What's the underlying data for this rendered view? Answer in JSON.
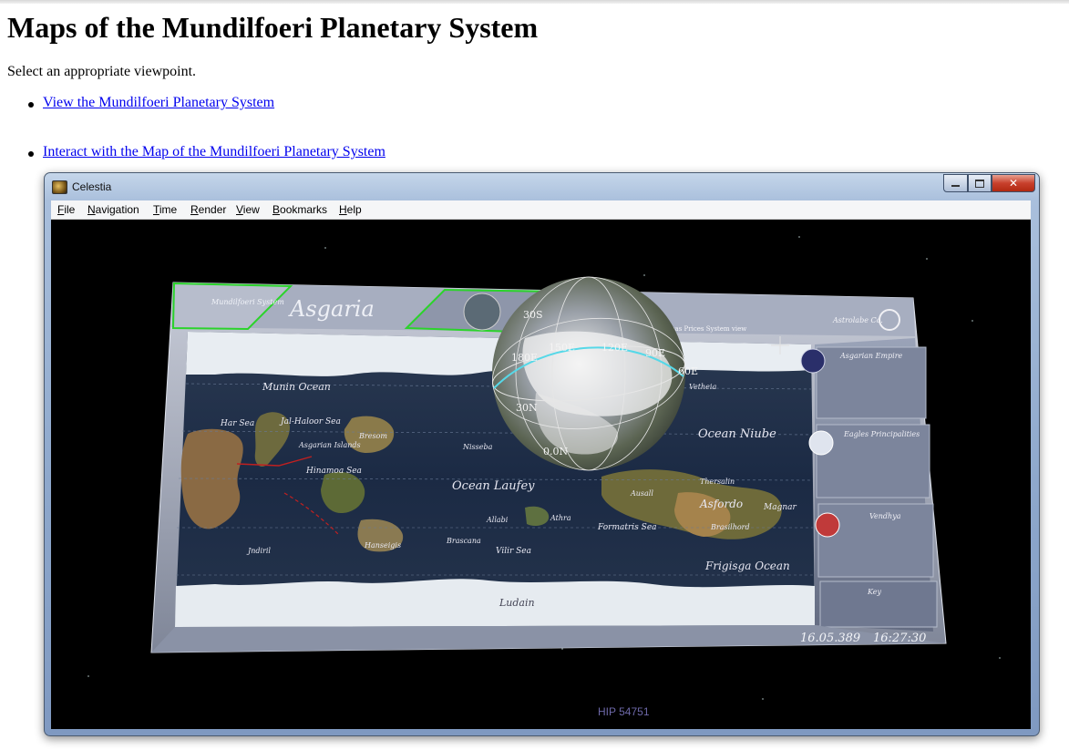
{
  "page": {
    "title": "Maps of the Mundilfoeri Planetary System",
    "intro": "Select an appropriate viewpoint.",
    "links": [
      {
        "label": "View the Mundilfoeri Planetary System"
      },
      {
        "label": "Interact with the Map of the Mundilfoeri Planetary System"
      }
    ]
  },
  "window": {
    "title": "Celestia",
    "close_label": "✕",
    "menu": [
      "File",
      "Navigation",
      "Time",
      "Render",
      "View",
      "Bookmarks",
      "Help"
    ]
  },
  "viewport": {
    "star_label": "HIP 54751",
    "panel": {
      "logo_text": "Mundilfoeri System",
      "planet_name": "Asgaria",
      "brand": "Astrolabe Co.",
      "toggles": "Areas  Prices  System view",
      "factions": [
        "Asgarian Empire",
        "Eagles Principalities",
        "Vendhya"
      ],
      "key_title": "Key",
      "date": "16.05.389",
      "time": "16:27:30"
    },
    "map_labels": [
      "Munin Ocean",
      "Har Sea",
      "Jal-Haloor Sea",
      "Asgarian Islands",
      "Bresom",
      "Nisseba",
      "Hinamoa Sea",
      "Ocean Laufey",
      "Ocean Niube",
      "Ausall",
      "Asfordo",
      "Brasilhord",
      "Magnar",
      "Formatris Sea",
      "Allabi",
      "Vilir Sea",
      "Brascana",
      "Frigisga Ocean",
      "Ludain",
      "Hanseigis",
      "Jndiril",
      "Athra",
      "Thersalin",
      "Vetheia"
    ],
    "globe_labels": [
      "30S",
      "150E",
      "120E",
      "90E",
      "180E",
      "60E",
      "30N",
      "0.0N"
    ]
  }
}
